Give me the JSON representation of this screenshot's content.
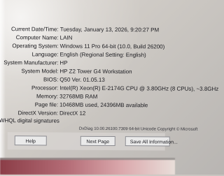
{
  "system_info": {
    "rows": [
      {
        "label": "Current Date/Time:",
        "value": "Tuesday, January 13, 2026, 9:20:27 PM"
      },
      {
        "label": "Computer Name:",
        "value": "LAIN"
      },
      {
        "label": "Operating System:",
        "value": "Windows 11 Pro 64-bit (10.0, Build 26200)"
      },
      {
        "label": "Language:",
        "value": "English (Regional Setting: English)"
      },
      {
        "label": "System Manufacturer:",
        "value": "HP"
      },
      {
        "label": "System Model:",
        "value": "HP Z2 Tower G4 Workstation"
      },
      {
        "label": "BIOS:",
        "value": "Q50 Ver. 01.05.13"
      },
      {
        "label": "Processor:",
        "value": "Intel(R) Xeon(R) E-2174G CPU @ 3.80GHz (8 CPUs), ~3.8GHz"
      },
      {
        "label": "Memory:",
        "value": "32768MB RAM"
      },
      {
        "label": "Page file:",
        "value": "10468MB used, 24396MB available"
      },
      {
        "label": "DirectX Version:",
        "value": "DirectX 12"
      }
    ],
    "whql_check": "WHQL digital signatures"
  },
  "footer": {
    "copyright": "DxDiag 10.00.26100.7309 64-bit Unicode  Copyright © Microsoft",
    "buttons": {
      "help": "Help",
      "next": "Next Page",
      "save": "Save All Information..."
    }
  }
}
